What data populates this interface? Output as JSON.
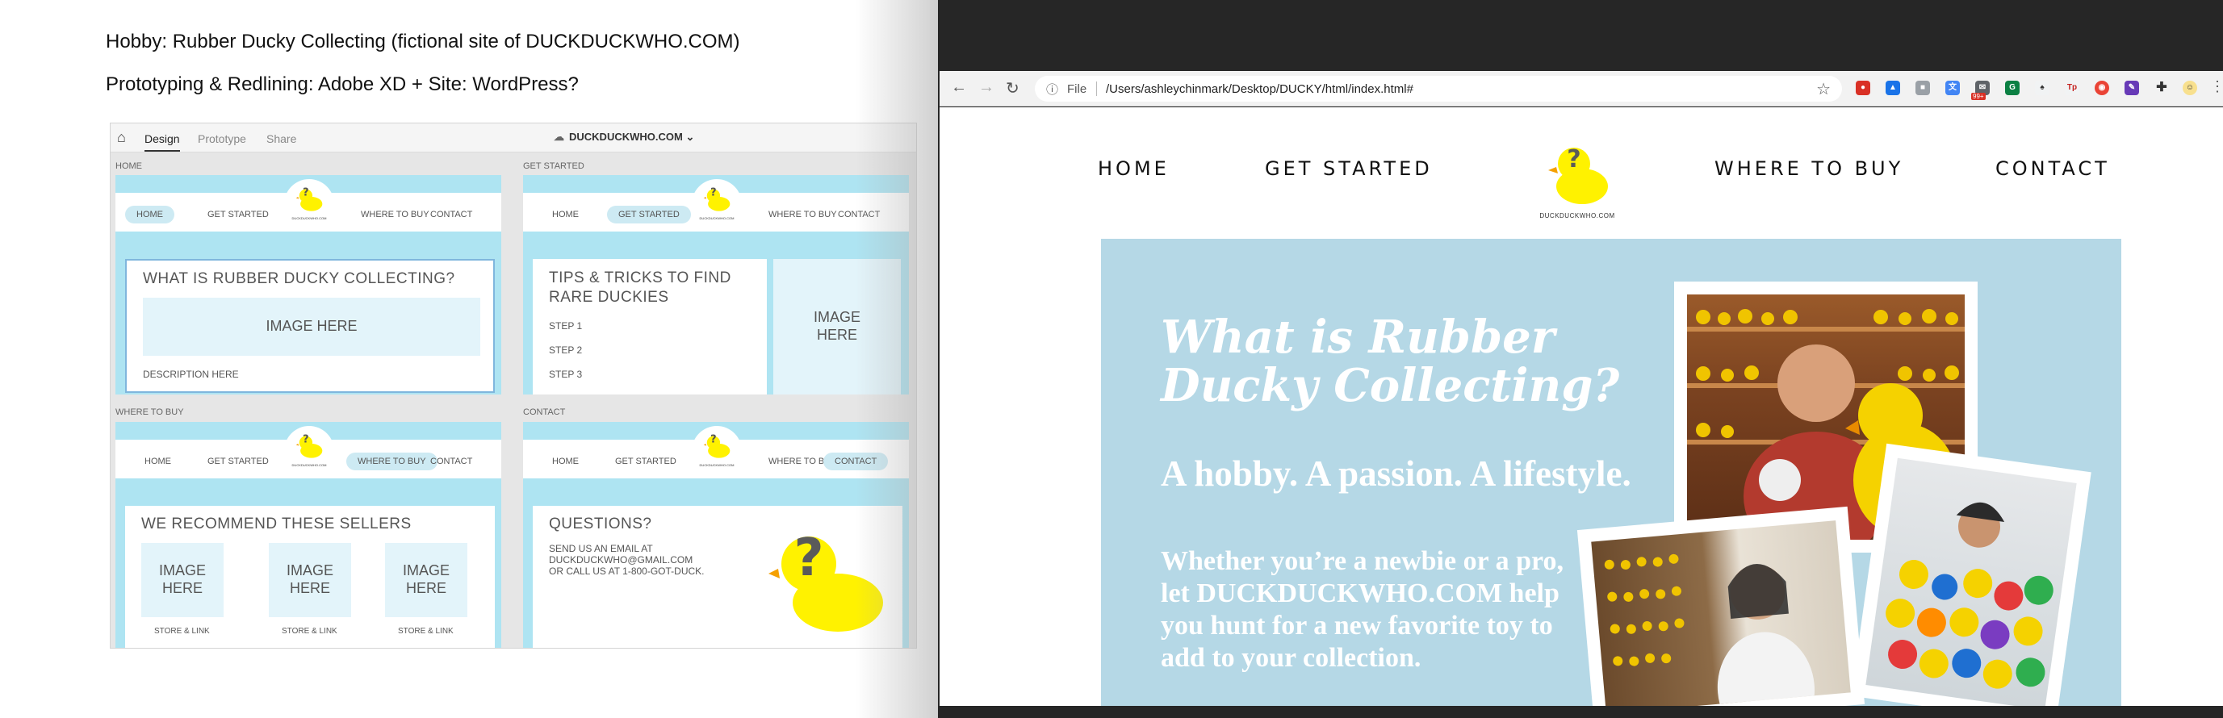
{
  "slide": {
    "line1": "Hobby: Rubber Ducky Collecting (fictional site of DUCKDUCKWHO.COM)",
    "line2": "Prototyping & Redlining: Adobe XD + Site: WordPress?"
  },
  "xd": {
    "tabs": [
      "Design",
      "Prototype",
      "Share"
    ],
    "doc_title": "DUCKDUCKWHO.COM",
    "nav": [
      "HOME",
      "GET STARTED",
      "WHERE TO BUY",
      "CONTACT"
    ],
    "logo_text": "DUCKDUCKWHO.COM",
    "artboards": {
      "home": {
        "label": "HOME",
        "heading": "WHAT IS RUBBER DUCKY COLLECTING?",
        "image": "IMAGE HERE",
        "description": "DESCRIPTION HERE"
      },
      "get_started": {
        "label": "GET STARTED",
        "heading": "TIPS & TRICKS TO FIND RARE DUCKIES",
        "steps": [
          "STEP 1",
          "STEP 2",
          "STEP 3"
        ],
        "image": "IMAGE HERE"
      },
      "where_to_buy": {
        "label": "WHERE TO BUY",
        "heading": "WE RECOMMEND THESE SELLERS",
        "image": "IMAGE HERE",
        "store_link": "STORE & LINK"
      },
      "contact": {
        "label": "CONTACT",
        "heading": "QUESTIONS?",
        "line1": "SEND US AN EMAIL AT",
        "line2": "DUCKDUCKWHO@GMAIL.COM",
        "line3": "OR CALL US AT 1-800-GOT-DUCK."
      }
    }
  },
  "browser": {
    "omnibox_label": "File",
    "url": "/Users/ashleychinmark/Desktop/DUCKY/html/index.html#",
    "badge": "99+"
  },
  "site": {
    "nav": [
      "HOME",
      "GET STARTED",
      "WHERE TO BUY",
      "CONTACT"
    ],
    "logo_text": "DUCKDUCKWHO.COM",
    "hero": {
      "title": "What is Rubber Ducky Collecting?",
      "subtitle": "A hobby. A passion. A lifestyle.",
      "body": "Whether you’re a newbie or a pro, let DUCKDUCKWHO.COM help you hunt for a new favorite toy to add to your collection."
    }
  },
  "colors": {
    "hero_bg": "#b5d8e6",
    "artboard_bg": "#aee4f2",
    "duck_yellow": "#fff200",
    "duck_question": "#5a5a5a"
  }
}
